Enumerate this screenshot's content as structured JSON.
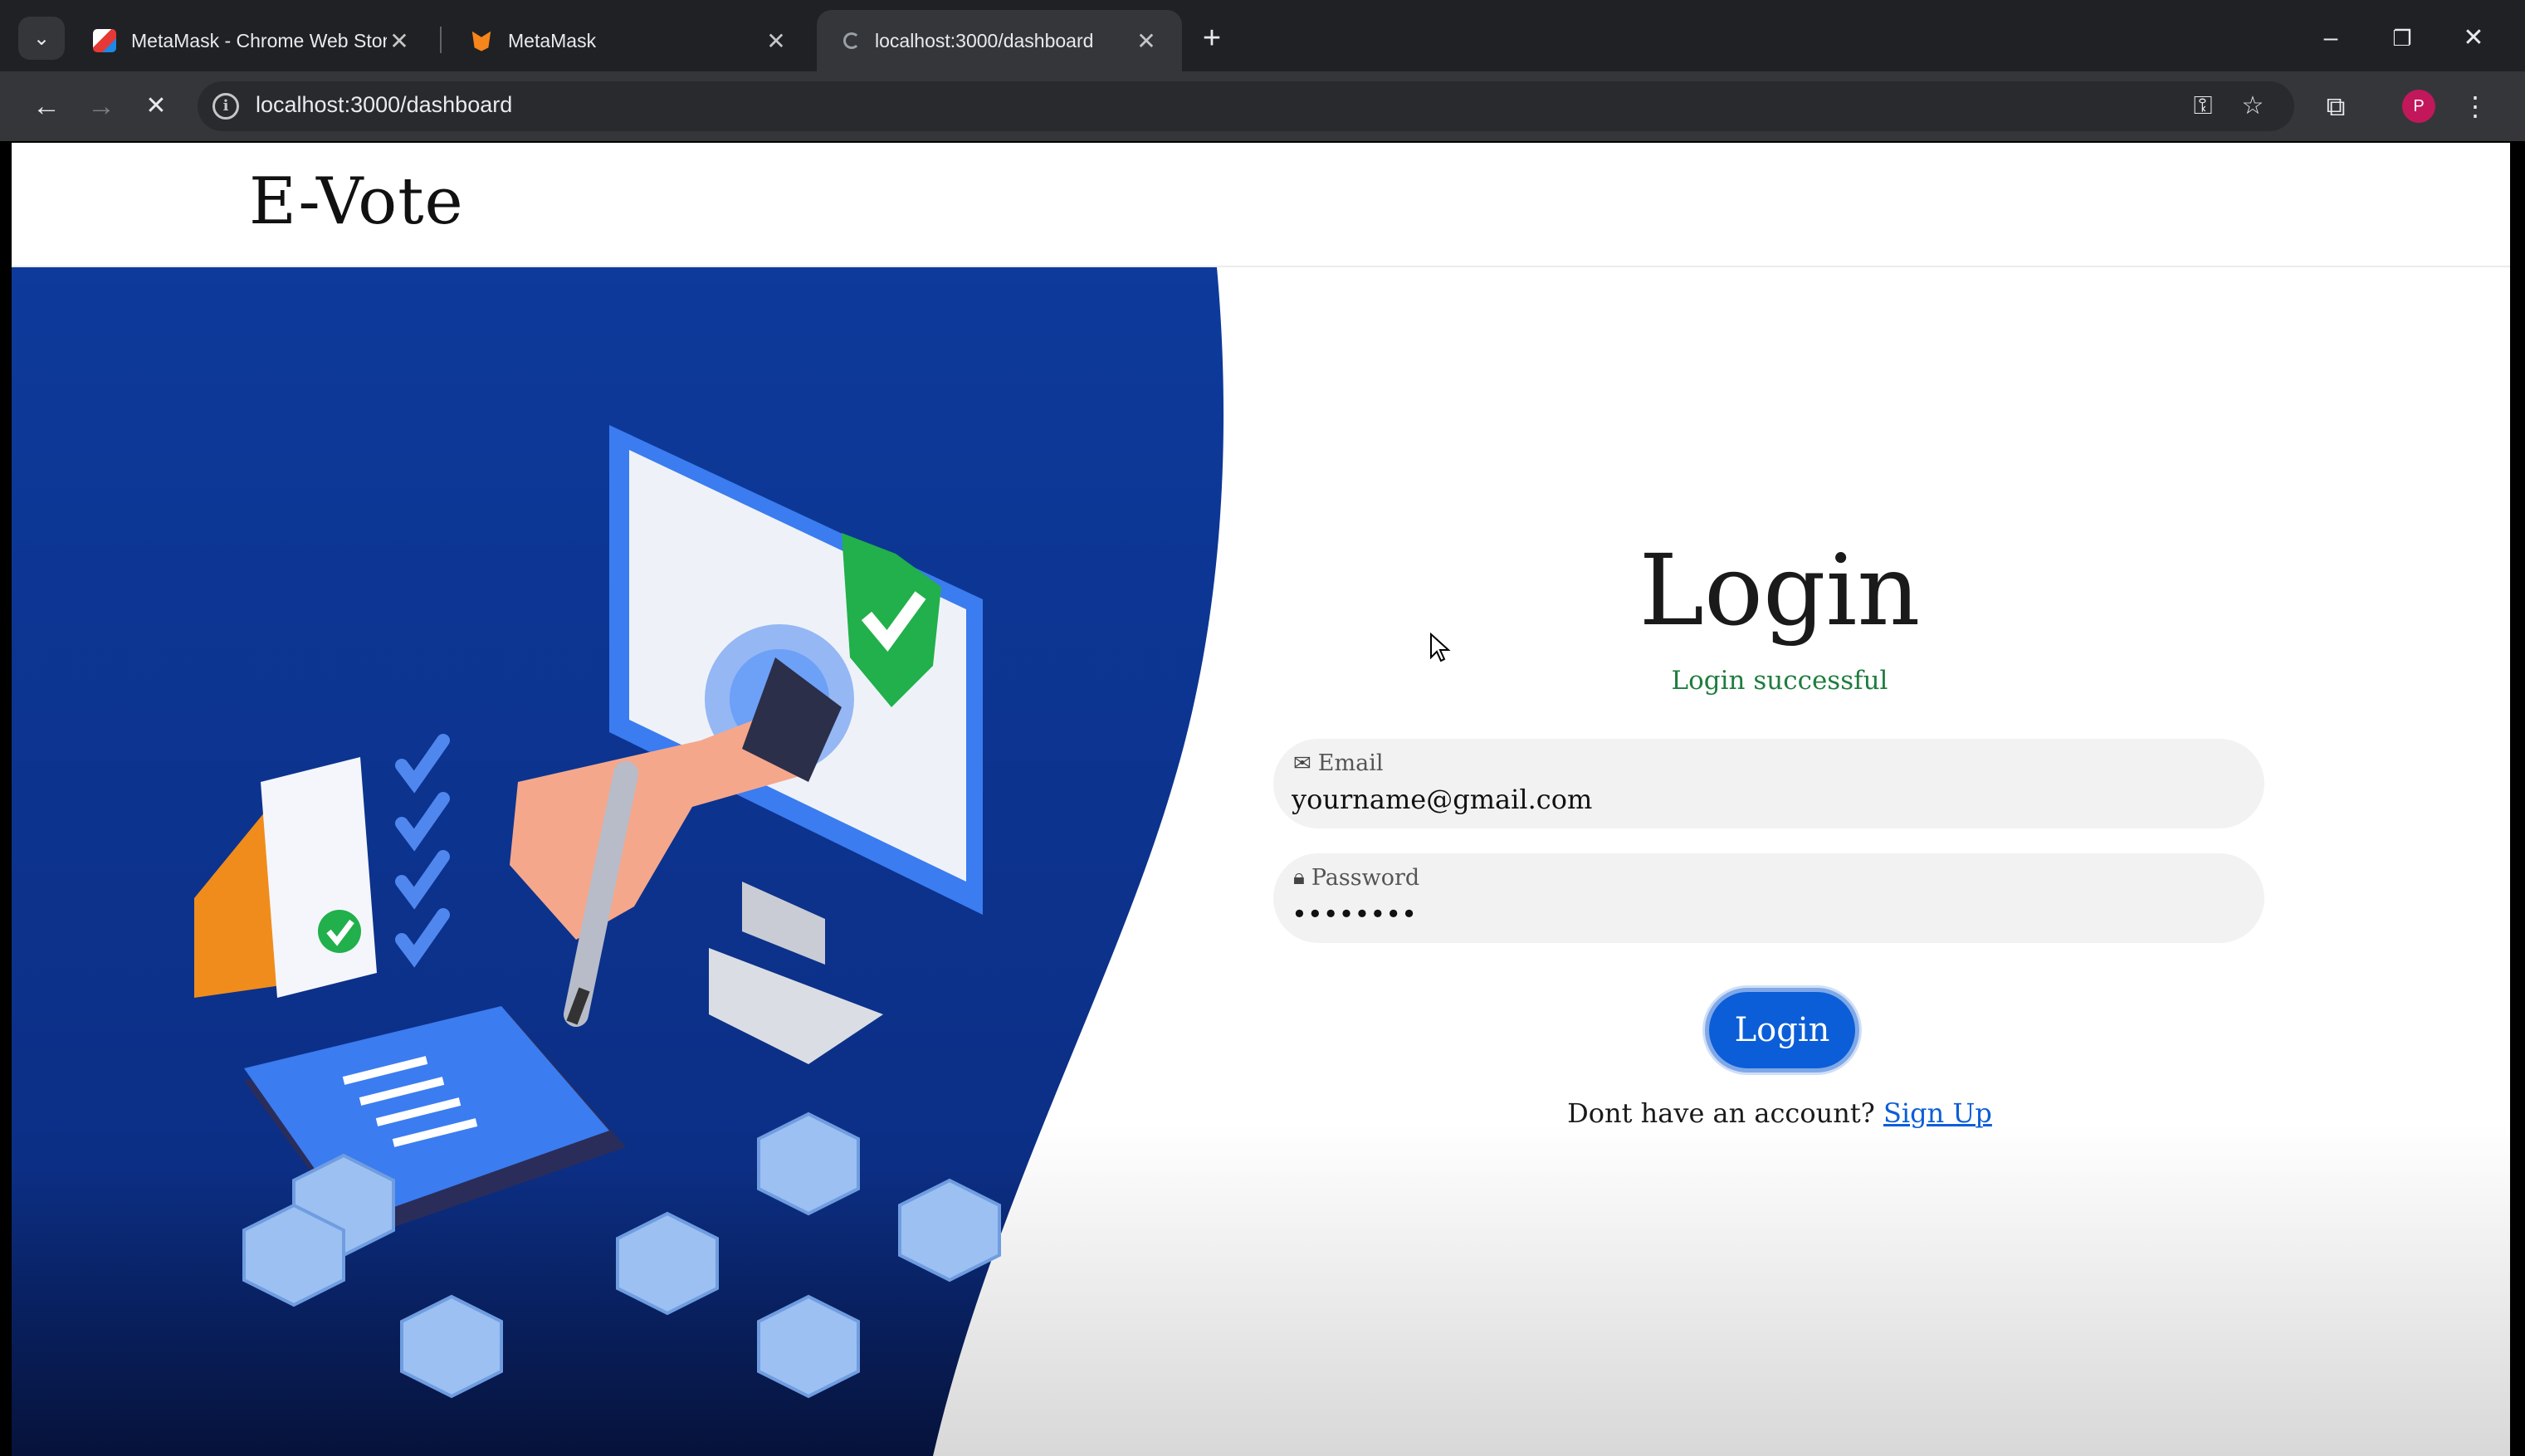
{
  "browser": {
    "tabs": [
      {
        "title": "MetaMask - Chrome Web Store",
        "active": false
      },
      {
        "title": "MetaMask",
        "active": false
      },
      {
        "title": "localhost:3000/dashboard",
        "active": true
      }
    ],
    "address": "localhost:3000/dashboard"
  },
  "site": {
    "brand": "E-Vote"
  },
  "login": {
    "title": "Login",
    "message": "Login successful",
    "email_label": "Email",
    "email_value": "yourname@gmail.com",
    "password_label": "Password",
    "password_value": "••••••••",
    "button": "Login",
    "signup_prompt": "Dont have an account?",
    "signup_link": "Sign Up"
  },
  "colors": {
    "hero_blue": "#0d3a9b",
    "primary": "#0b5ed7",
    "success": "#1e7d3e"
  }
}
